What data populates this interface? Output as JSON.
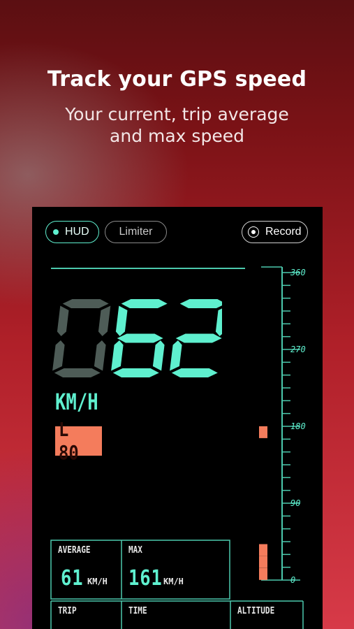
{
  "headline": {
    "title": "Track your GPS speed",
    "subtitle": "Your current, trip average and max speed"
  },
  "toolbar": {
    "hud_label": "HUD",
    "limiter_label": "Limiter",
    "record_label": "Record"
  },
  "speedometer": {
    "speed_digits": [
      "0",
      "6",
      "2"
    ],
    "unit": "KM/H",
    "limit_label": "L 80",
    "scale_labels": [
      "360",
      "270",
      "180",
      "90",
      "0"
    ],
    "max_scale": 360,
    "markers": [
      167,
      29,
      15,
      1
    ],
    "accent_color": "#5ff0cf",
    "limit_color": "#f47c5c"
  },
  "stats": {
    "average": {
      "label": "AVERAGE",
      "value": "61",
      "unit": "KM/H"
    },
    "max": {
      "label": "MAX",
      "value": "161",
      "unit": "KM/H"
    },
    "trip": {
      "label": "TRIP"
    },
    "time": {
      "label": "TIME"
    },
    "altitude": {
      "label": "ALTITUDE"
    }
  }
}
